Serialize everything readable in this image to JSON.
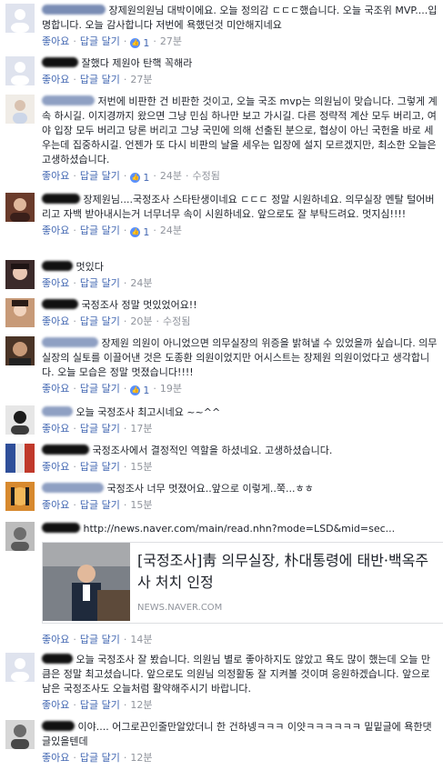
{
  "comments": [
    {
      "text": "장제원의원님 대박이에요. 오늘 정의감 ㄷㄷㄷ했습니다. 오늘 국조위 MVP....입명합니다. 오늘 감사합니다 저번에 욕했던것 미안해지네요",
      "like_label": "좋아요",
      "reply_label": "답글 달기",
      "like_count": "1",
      "time": "27분",
      "edited": ""
    },
    {
      "text": "잘했다 제원아 탄핵 꼭해라",
      "like_label": "좋아요",
      "reply_label": "답글 달기",
      "like_count": "",
      "time": "27분",
      "edited": ""
    },
    {
      "text": "저번에 비판한 건 비판한 것이고, 오늘 국조 mvp는 의원님이 맞습니다. 그렇게 계속 하시길. 이지경까지 왔으면 그냥 민심 하나만 보고 가시길. 다른 정략적 계산 모두 버리고, 여야 입장 모두 버리고 당론 버리고 그냥 국민에 의해 선출된 분으로, 협상이 아닌 국헌을 바로 세우는데 집중하시길. 언젠가 또 다시 비판의 날을 세우는 입장에 설지 모르겠지만, 최소한 오늘은 고생하셨습니다.",
      "like_label": "좋아요",
      "reply_label": "답글 달기",
      "like_count": "1",
      "time": "24분",
      "edited": "수정됨"
    },
    {
      "text": "장제원님....국정조사 스타탄생이네요 ㄷㄷㄷ 정말 시원하네요. 의무실장 멘탈 털어버리고 자백 받아내시는거 너무너무 속이 시원하네요. 앞으로도 잘 부탁드려요. 멋지심!!!!",
      "like_label": "좋아요",
      "reply_label": "답글 달기",
      "like_count": "1",
      "time": "24분",
      "edited": ""
    },
    {
      "text": "멋있다",
      "like_label": "좋아요",
      "reply_label": "답글 달기",
      "like_count": "",
      "time": "24분",
      "edited": ""
    },
    {
      "text": "국정조사 정말 멋있었어요!!",
      "like_label": "좋아요",
      "reply_label": "답글 달기",
      "like_count": "",
      "time": "20분",
      "edited": "수정됨"
    },
    {
      "text": "장제원 의원이 아니었으면 의무실장의 위증을 밝혀낼 수 있었을까 싶습니다. 의무실장의 실토를 이끌어낸 것은 도종환 의원이었지만 어시스트는 장제원 의원이었다고 생각합니다. 오늘 모습은 정말 멋졌습니다!!!!",
      "like_label": "좋아요",
      "reply_label": "답글 달기",
      "like_count": "1",
      "time": "19분",
      "edited": ""
    },
    {
      "text": "오늘 국정조사 최고시네요 ~~^^",
      "like_label": "좋아요",
      "reply_label": "답글 달기",
      "like_count": "",
      "time": "17분",
      "edited": ""
    },
    {
      "text": "국정조사에서 결정적인 역할을 하셨네요. 고생하셨습니다.",
      "like_label": "좋아요",
      "reply_label": "답글 달기",
      "like_count": "",
      "time": "15분",
      "edited": ""
    },
    {
      "text": "국정조사 너무 멋졌어요..앞으로 이렇게..쭉...ㅎㅎ",
      "like_label": "좋아요",
      "reply_label": "답글 달기",
      "like_count": "",
      "time": "15분",
      "edited": ""
    },
    {
      "text": "http://news.naver.com/main/read.nhn?mode=LSD&mid=sec...",
      "like_label": "좋아요",
      "reply_label": "답글 달기",
      "like_count": "",
      "time": "14분",
      "edited": "",
      "link_title": "[국정조사]靑 의무실장, 朴대통령에 태반·백옥주사 처치 인정",
      "link_domain": "NEWS.NAVER.COM"
    },
    {
      "text": "오늘 국정조사 잘 봤습니다. 의원님 별로 좋아하지도 않았고 욕도 많이 했는데 오늘 만큼은 정말 최고셨습니다. 앞으로도 의원님 의정활동 잘 지켜볼 것이며 응원하겠습니다. 앞으로 남은 국정조사도 오늘처럼 활약해주시기 바랍니다.",
      "like_label": "좋아요",
      "reply_label": "답글 달기",
      "like_count": "",
      "time": "12분",
      "edited": ""
    },
    {
      "text": "이야.... 어그로끈인줄만알았더니 한 건하넹ㅋㅋㅋ 이얏ㅋㅋㅋㅋㅋㅋ 밑밑글에 욕한댓글있을텐데",
      "like_label": "좋아요",
      "reply_label": "답글 달기",
      "like_count": "",
      "time": "12분",
      "edited": ""
    }
  ]
}
